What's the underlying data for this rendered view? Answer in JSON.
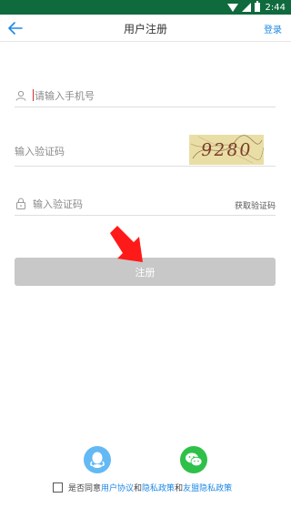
{
  "status_bar": {
    "time": "2:44"
  },
  "app_bar": {
    "back_icon": "arrow-left-icon",
    "title": "用户注册",
    "login": "登录"
  },
  "form": {
    "phone_placeholder": "请输入手机号",
    "captcha_placeholder": "输入验证码",
    "captcha_text": "9280",
    "sms_placeholder": "输入验证码",
    "sms_button": "获取验证码"
  },
  "register_button": "注册",
  "social": [
    "qq-icon",
    "wechat-icon"
  ],
  "agreement": {
    "prefix": "是否同意",
    "user_agreement": "用户协议",
    "and1": "和",
    "privacy_policy": "隐私政策",
    "and2": "和",
    "umeng_policy": "友盟隐私政策"
  },
  "colors": {
    "status_bar": "#0f6a3d",
    "accent": "#1e88e5",
    "button_disabled": "#c8c8c8",
    "qq": "#63b9f4",
    "wechat": "#2fc04a"
  }
}
